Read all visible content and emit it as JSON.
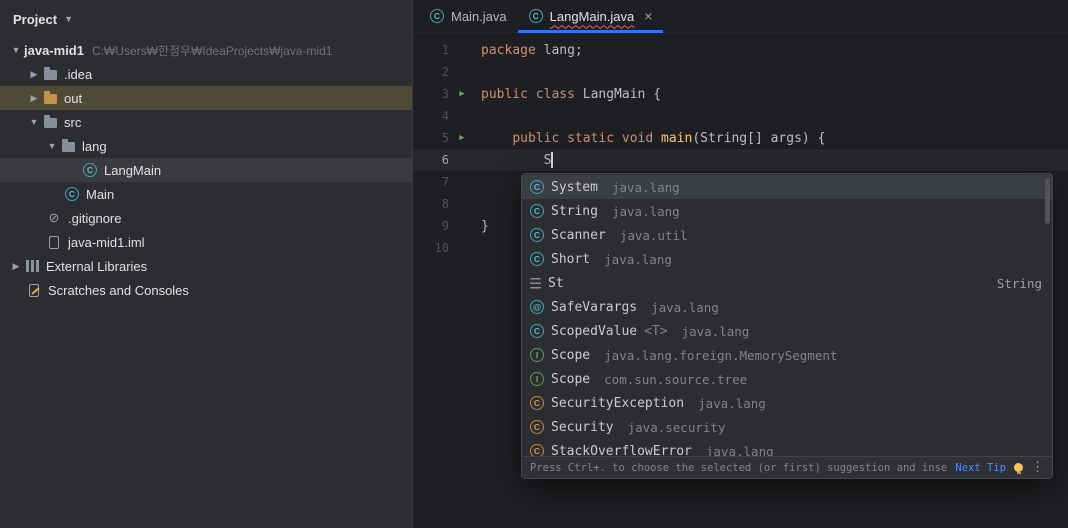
{
  "project_panel": {
    "header": "Project",
    "tree": [
      {
        "label": "java-mid1",
        "path": "C:₩Users₩한정우₩IdeaProjects₩java-mid1",
        "chevron": "down",
        "icon": "none",
        "indent": 8,
        "bold": true
      },
      {
        "label": ".idea",
        "chevron": "right",
        "icon": "folder",
        "indent": 26
      },
      {
        "label": "out",
        "chevron": "right",
        "icon": "folder-out",
        "indent": 26,
        "sel": "olive"
      },
      {
        "label": "src",
        "chevron": "down",
        "icon": "folder",
        "indent": 26
      },
      {
        "label": "lang",
        "chevron": "down",
        "icon": "folder",
        "indent": 44
      },
      {
        "label": "LangMain",
        "icon": "class",
        "indent": 82,
        "sel": "gray"
      },
      {
        "label": "Main",
        "icon": "class",
        "indent": 64
      },
      {
        "label": ".gitignore",
        "icon": "gitignore",
        "indent": 46
      },
      {
        "label": "java-mid1.iml",
        "icon": "file",
        "indent": 46
      },
      {
        "label": "External Libraries",
        "chevron": "right",
        "icon": "lib",
        "indent": 8
      },
      {
        "label": "Scratches and Consoles",
        "icon": "scratch",
        "indent": 26
      }
    ]
  },
  "editor": {
    "tabs": [
      {
        "label": "Main.java",
        "icon": "class",
        "active": false
      },
      {
        "label": "LangMain.java",
        "icon": "class",
        "active": true,
        "close": "×",
        "error_underline": true
      }
    ],
    "lines": [
      {
        "num": "1",
        "tokens": [
          {
            "text": "package",
            "style": "kw"
          },
          {
            "text": " lang;",
            "style": "plain"
          }
        ]
      },
      {
        "num": "2",
        "tokens": []
      },
      {
        "num": "3",
        "run": true,
        "tokens": [
          {
            "text": "public class ",
            "style": "kw"
          },
          {
            "text": "LangMain {",
            "style": "plain"
          }
        ]
      },
      {
        "num": "4",
        "tokens": []
      },
      {
        "num": "5",
        "run": true,
        "tokens": [
          {
            "text": "    ",
            "style": "plain"
          },
          {
            "text": "public static void ",
            "style": "kw"
          },
          {
            "text": "main",
            "style": "method"
          },
          {
            "text": "(String[] args) {",
            "style": "plain"
          }
        ]
      },
      {
        "num": "6",
        "current": true,
        "caret": true,
        "tokens": [
          {
            "text": "        S",
            "style": "plain"
          }
        ]
      },
      {
        "num": "7",
        "tokens": []
      },
      {
        "num": "8",
        "tokens": []
      },
      {
        "num": "9",
        "tokens": [
          {
            "text": "}",
            "style": "plain"
          }
        ]
      },
      {
        "num": "10",
        "tokens": []
      }
    ]
  },
  "completion": {
    "items": [
      {
        "icon": "class",
        "name": "System",
        "tail": "java.lang",
        "selected": true
      },
      {
        "icon": "class",
        "name": "String",
        "tail": "java.lang"
      },
      {
        "icon": "class",
        "name": "Scanner",
        "tail": "java.util"
      },
      {
        "icon": "class",
        "name": "Short",
        "tail": "java.lang"
      },
      {
        "icon": "template",
        "name": "St",
        "right": "String"
      },
      {
        "icon": "annotation",
        "name": "SafeVarargs",
        "tail": "java.lang"
      },
      {
        "icon": "class",
        "name": "ScopedValue",
        "generics": "<T>",
        "tail": "java.lang"
      },
      {
        "icon": "interface",
        "name": "Scope",
        "tail": "java.lang.foreign.MemorySegment"
      },
      {
        "icon": "interface",
        "name": "Scope",
        "tail": "com.sun.source.tree"
      },
      {
        "icon": "exception",
        "name": "SecurityException",
        "tail": "java.lang"
      },
      {
        "icon": "exception",
        "name": "Security",
        "tail": "java.security"
      },
      {
        "icon": "exception",
        "name": "StackOverflowError",
        "tail": "java.lang"
      }
    ],
    "footer": {
      "hint": "Press Ctrl+. to choose the selected (or first) suggestion and insert a dot afterwards",
      "next_tip": "Next Tip"
    }
  },
  "colors": {
    "accent_blue": "#3574f0",
    "selection_gray": "#393b40",
    "selection_olive": "#4f4a36",
    "run_green": "#57ad5c",
    "error_red": "#f55e69"
  }
}
